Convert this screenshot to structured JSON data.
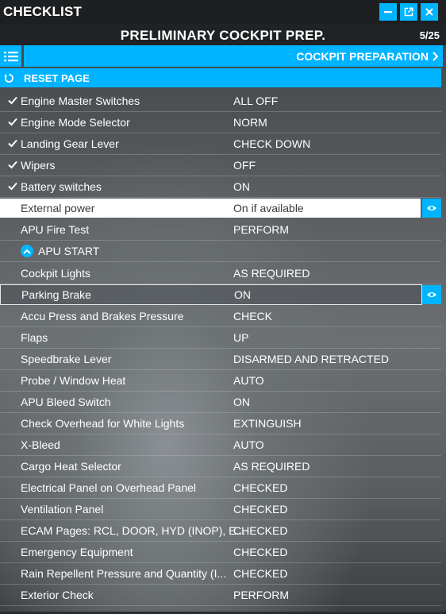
{
  "window": {
    "title": "CHECKLIST",
    "buttons": [
      {
        "icon": "minimize-icon"
      },
      {
        "icon": "external-window-icon"
      },
      {
        "icon": "close-icon"
      }
    ]
  },
  "header": {
    "title": "PRELIMINARY COCKPIT PREP.",
    "page_count": "5/25"
  },
  "nav": {
    "menu_icon": "list-icon",
    "section_label": "COCKPIT PREPARATION",
    "section_icon": "chevron-right-icon"
  },
  "reset": {
    "label": "RESET PAGE",
    "icon": "reset-icon"
  },
  "colors": {
    "accent": "#00b4ff",
    "titlebar": "#1d1f21",
    "text": "#ffffff"
  },
  "items": [
    {
      "name": "Engine Master Switches",
      "value": "ALL OFF",
      "checked": true
    },
    {
      "name": "Engine Mode Selector",
      "value": "NORM",
      "checked": true
    },
    {
      "name": "Landing Gear Lever",
      "value": "CHECK DOWN",
      "checked": true
    },
    {
      "name": "Wipers",
      "value": "OFF",
      "checked": true
    },
    {
      "name": "Battery switches",
      "value": "ON",
      "checked": true
    },
    {
      "name": "External power",
      "value": "On if available",
      "checked": false,
      "state": "active"
    },
    {
      "name": "APU Fire Test",
      "value": "PERFORM",
      "checked": false
    },
    {
      "name": "APU START",
      "value": "",
      "checked": false,
      "type": "group"
    },
    {
      "name": "Cockpit Lights",
      "value": "AS REQUIRED",
      "checked": false
    },
    {
      "name": "Parking Brake",
      "value": "ON",
      "checked": false,
      "state": "selected"
    },
    {
      "name": "Accu Press and Brakes Pressure",
      "value": "CHECK",
      "checked": false
    },
    {
      "name": "Flaps",
      "value": "UP",
      "checked": false
    },
    {
      "name": "Speedbrake Lever",
      "value": "DISARMED AND RETRACTED",
      "checked": false
    },
    {
      "name": "Probe / Window Heat",
      "value": "AUTO",
      "checked": false
    },
    {
      "name": "APU Bleed Switch",
      "value": "ON",
      "checked": false
    },
    {
      "name": "Check Overhead for White Lights",
      "value": "EXTINGUISH",
      "checked": false
    },
    {
      "name": "X-Bleed",
      "value": "AUTO",
      "checked": false
    },
    {
      "name": "Cargo Heat Selector",
      "value": "AS REQUIRED",
      "checked": false
    },
    {
      "name": "Electrical Panel on Overhead Panel",
      "value": "CHECKED",
      "checked": false
    },
    {
      "name": "Ventilation Panel",
      "value": "CHECKED",
      "checked": false
    },
    {
      "name": "ECAM Pages: RCL, DOOR, HYD (INOP), E...",
      "value": "CHECKED",
      "checked": false
    },
    {
      "name": "Emergency Equipment",
      "value": "CHECKED",
      "checked": false
    },
    {
      "name": "Rain Repellent Pressure and Quantity (I...",
      "value": "CHECKED",
      "checked": false
    },
    {
      "name": "Exterior Check",
      "value": "PERFORM",
      "checked": false
    }
  ]
}
